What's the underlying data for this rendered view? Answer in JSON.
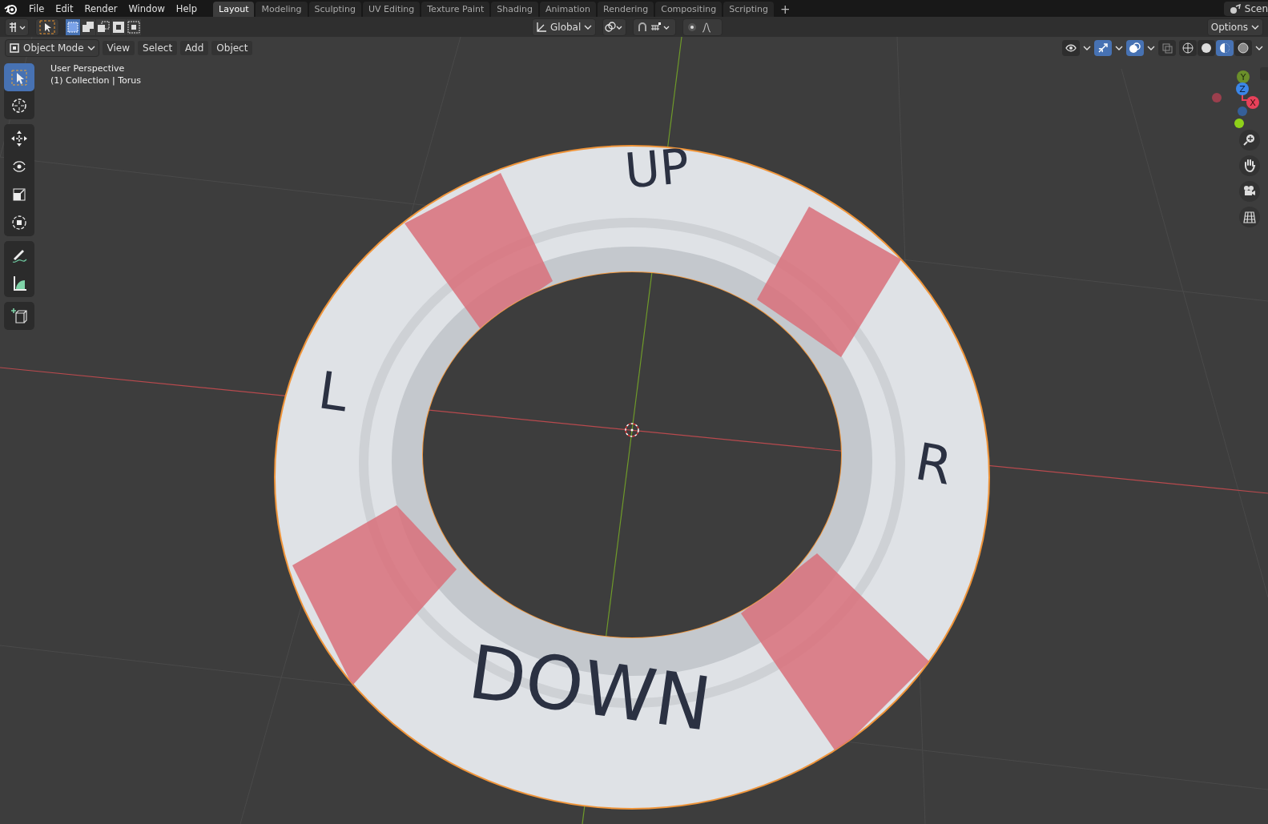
{
  "menu": [
    {
      "label": "File"
    },
    {
      "label": "Edit"
    },
    {
      "label": "Render"
    },
    {
      "label": "Window"
    },
    {
      "label": "Help"
    }
  ],
  "workspaces": [
    {
      "label": "Layout",
      "selected": true
    },
    {
      "label": "Modeling",
      "selected": false
    },
    {
      "label": "Sculpting",
      "selected": false
    },
    {
      "label": "UV Editing",
      "selected": false
    },
    {
      "label": "Texture Paint",
      "selected": false
    },
    {
      "label": "Shading",
      "selected": false
    },
    {
      "label": "Animation",
      "selected": false
    },
    {
      "label": "Rendering",
      "selected": false
    },
    {
      "label": "Compositing",
      "selected": false
    },
    {
      "label": "Scripting",
      "selected": false
    }
  ],
  "add_workspace": "+",
  "scene_label": "Scen",
  "select_modes": [
    {
      "kind": "set",
      "selected": true
    },
    {
      "kind": "extend",
      "selected": false
    },
    {
      "kind": "subtract",
      "selected": false
    },
    {
      "kind": "difference",
      "selected": false
    },
    {
      "kind": "intersect",
      "selected": false
    }
  ],
  "orientation": "Global",
  "options": "Options",
  "viewport_header": {
    "mode": "Object Mode",
    "menus": [
      "View",
      "Select",
      "Add",
      "Object"
    ]
  },
  "toggles": [
    {
      "kind": "visibility",
      "on": false
    },
    {
      "kind": "gizmos",
      "on": true
    },
    {
      "kind": "overlays",
      "on": true
    },
    {
      "kind": "xray",
      "on": false
    }
  ],
  "shading": [
    {
      "kind": "wireframe",
      "selected": false
    },
    {
      "kind": "solid",
      "selected": false
    },
    {
      "kind": "material",
      "selected": true
    },
    {
      "kind": "rendered",
      "selected": false
    }
  ],
  "tools": [
    {
      "kind": "select",
      "selected": true
    },
    {
      "kind": "cursor",
      "selected": false
    },
    {
      "kind": "move",
      "selected": false
    },
    {
      "kind": "rotate",
      "selected": false
    },
    {
      "kind": "scale",
      "selected": false
    },
    {
      "kind": "transform",
      "selected": false
    },
    {
      "kind": "annotate",
      "selected": false
    },
    {
      "kind": "measure",
      "selected": false
    },
    {
      "kind": "add-cube",
      "selected": false
    }
  ],
  "overlay_text": [
    "User Perspective",
    "(1) Collection | Torus"
  ],
  "gizmo_axes": [
    {
      "kind": "y",
      "label": "Y"
    },
    {
      "kind": "z",
      "label": "Z"
    },
    {
      "kind": "x",
      "label": "X"
    }
  ],
  "nav_buttons": [
    {
      "kind": "zoom"
    },
    {
      "kind": "pan"
    },
    {
      "kind": "camera"
    },
    {
      "kind": "ortho"
    }
  ],
  "object_labels": [
    {
      "kind": "up",
      "text": "UP"
    },
    {
      "kind": "left",
      "text": "L"
    },
    {
      "kind": "right",
      "text": "R"
    },
    {
      "kind": "down",
      "text": "DOWN"
    }
  ]
}
